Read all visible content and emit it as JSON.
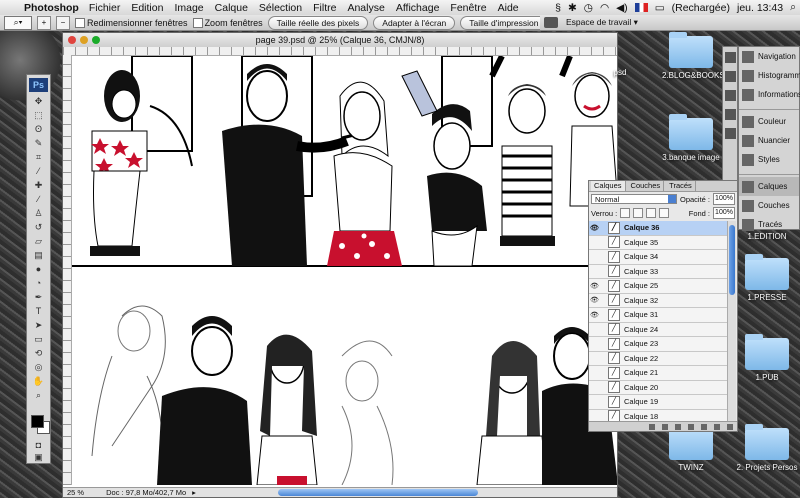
{
  "menubar": {
    "app_name": "Photoshop",
    "items": [
      "Fichier",
      "Edition",
      "Image",
      "Calque",
      "Sélection",
      "Filtre",
      "Analyse",
      "Affichage",
      "Fenêtre",
      "Aide"
    ],
    "battery_status": "(Rechargée)",
    "clock": "jeu. 13:43"
  },
  "options_bar": {
    "resize_windows_label": "Redimensionner fenêtres",
    "zoom_windows_label": "Zoom fenêtres",
    "actual_pixels": "Taille réelle des pixels",
    "fit_screen": "Adapter à l'écran",
    "print_size": "Taille d'impression",
    "workspace": "Espace de travail"
  },
  "document": {
    "title": "page 39.psd @ 25% (Calque 36, CMJN/8)",
    "zoom": "25 %",
    "doc_info": "Doc : 97,8 Mo/402,7 Mo"
  },
  "dock": {
    "items": [
      "Navigation",
      "Histogramme",
      "Informations",
      "Couleur",
      "Nuancier",
      "Styles",
      "Calques",
      "Couches",
      "Tracés"
    ]
  },
  "layers_panel": {
    "tabs": [
      "Calques",
      "Couches",
      "Tracés"
    ],
    "blend_mode": "Normal",
    "opacity_label": "Opacité :",
    "opacity_value": "100%",
    "lock_label": "Verrou :",
    "fill_label": "Fond :",
    "fill_value": "100%",
    "layers": [
      {
        "name": "Calque 36",
        "visible": true,
        "active": true
      },
      {
        "name": "Calque 35",
        "visible": false,
        "active": false
      },
      {
        "name": "Calque 34",
        "visible": false,
        "active": false
      },
      {
        "name": "Calque 33",
        "visible": false,
        "active": false
      },
      {
        "name": "Calque 25",
        "visible": true,
        "active": false
      },
      {
        "name": "Calque 32",
        "visible": true,
        "active": false
      },
      {
        "name": "Calque 31",
        "visible": true,
        "active": false
      },
      {
        "name": "Calque 24",
        "visible": false,
        "active": false
      },
      {
        "name": "Calque 23",
        "visible": false,
        "active": false
      },
      {
        "name": "Calque 22",
        "visible": false,
        "active": false
      },
      {
        "name": "Calque 21",
        "visible": false,
        "active": false
      },
      {
        "name": "Calque 20",
        "visible": false,
        "active": false
      },
      {
        "name": "Calque 19",
        "visible": false,
        "active": false
      },
      {
        "name": "Calque 18",
        "visible": false,
        "active": false
      }
    ]
  },
  "desktop": {
    "files": [
      "psd",
      "2.BLOG&BOOKS",
      "3.banque image",
      "1.EDITION",
      "1.PRESSE",
      "1.PUB",
      "TWINZ",
      "2. Projets Persos"
    ]
  },
  "colors": {
    "accent_blue": "#3a78cf",
    "comic_red": "#c8102e"
  }
}
